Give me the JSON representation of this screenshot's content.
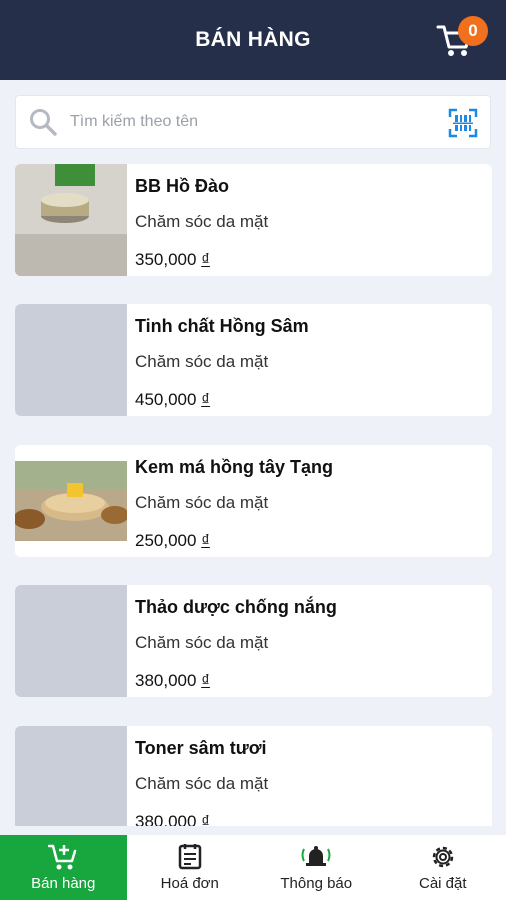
{
  "header": {
    "title": "BÁN HÀNG",
    "cart_count": "0"
  },
  "search": {
    "placeholder": "Tìm kiếm theo tên"
  },
  "products": [
    {
      "name": "BB Hồ Đào",
      "category": "Chăm sóc da mặt",
      "price": "350,000",
      "currency": "₫",
      "thumb": "jar-photo"
    },
    {
      "name": "Tinh chất Hồng Sâm",
      "category": "Chăm sóc da mặt",
      "price": "450,000",
      "currency": "₫",
      "thumb": "placeholder"
    },
    {
      "name": "Kem má hồng tây Tạng",
      "category": "Chăm sóc da mặt",
      "price": "250,000",
      "currency": "₫",
      "thumb": "herb-photo"
    },
    {
      "name": "Thảo dược chống nắng",
      "category": "Chăm sóc da mặt",
      "price": "380,000",
      "currency": "₫",
      "thumb": "placeholder"
    },
    {
      "name": "Toner sâm tươi",
      "category": "Chăm sóc da mặt",
      "price": "380,000",
      "currency": "₫",
      "thumb": "placeholder"
    }
  ],
  "nav": {
    "items": [
      {
        "label": "Bán hàng",
        "icon": "cart-plus-icon",
        "active": true
      },
      {
        "label": "Hoá đơn",
        "icon": "receipt-icon",
        "active": false
      },
      {
        "label": "Thông báo",
        "icon": "bell-icon",
        "active": false
      },
      {
        "label": "Cài đặt",
        "icon": "gear-icon",
        "active": false
      }
    ]
  },
  "colors": {
    "header_bg": "#262f4a",
    "badge": "#f0701e",
    "active_nav": "#18a63e",
    "scan_icon": "#1e88e5",
    "background": "#eef1f8"
  }
}
